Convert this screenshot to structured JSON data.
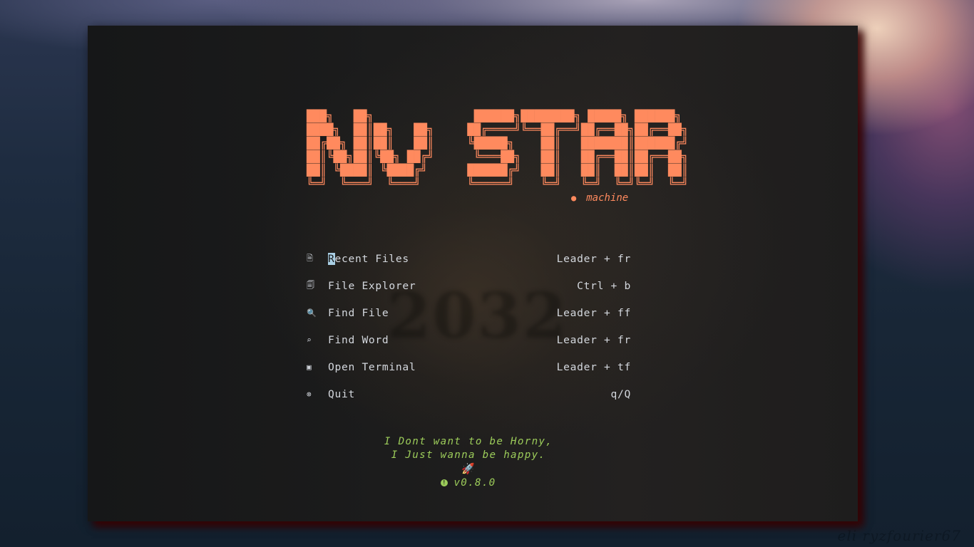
{
  "dashboard": {
    "logo_lines": [
      "███╗   ██╗               ██████╗████████╗ █████╗ ██████╗ ",
      "████╗  ██║██╗   ██╗     ██╔════╝╚══██╔══╝██╔══██╗██╔══██╗",
      "██╔██╗ ██║██║   ██║     ╚█████╗    ██║   ███████║██████╔╝",
      "██║╚██╗██║╚██╗ ██╔╝      ╚═══██╗   ██║   ██╔══██║██╔══██╗",
      "██║ ╚████║ ╚████╔╝      ██████╔╝   ██║   ██║  ██║██║  ██║",
      "╚═╝  ╚═══╝  ╚═══╝       ╚═════╝    ╚═╝   ╚═╝  ╚═╝╚═╝  ╚═╝"
    ],
    "logo_text": "NvSTAR",
    "subtitle": {
      "icon": "machine-icon",
      "glyph": "●",
      "text": "machine"
    },
    "background_art_text": "2032",
    "accent_color": "#ff8a5e",
    "footer_color": "#9ccc5a"
  },
  "menu": {
    "items": [
      {
        "icon": "file-icon",
        "glyph": "🗎",
        "label_first": "R",
        "label_rest": "ecent Files",
        "shortcut": "Leader + fr"
      },
      {
        "icon": "files-icon",
        "glyph": "🗐",
        "label_first": "F",
        "label_rest": "ile Explorer",
        "shortcut": "Ctrl + b"
      },
      {
        "icon": "file-search-icon",
        "glyph": "🔍",
        "label_first": "F",
        "label_rest": "ind File",
        "shortcut": "Leader + ff"
      },
      {
        "icon": "search-icon",
        "glyph": "⌕",
        "label_first": "F",
        "label_rest": "ind Word",
        "shortcut": "Leader + fr"
      },
      {
        "icon": "terminal-icon",
        "glyph": "▣",
        "label_first": "O",
        "label_rest": "pen Terminal",
        "shortcut": "Leader + tf"
      },
      {
        "icon": "quit-icon",
        "glyph": "⊗",
        "label_first": "Q",
        "label_rest": "uit",
        "shortcut": "q/Q"
      }
    ]
  },
  "footer": {
    "line1": "I Dont want to be Horny,",
    "line2": "I Just wanna be happy.",
    "rocket": "🚀",
    "version_icon": "!",
    "version": "v0.8.0"
  },
  "wallpaper": {
    "signature": "eli ryzfourier67"
  }
}
